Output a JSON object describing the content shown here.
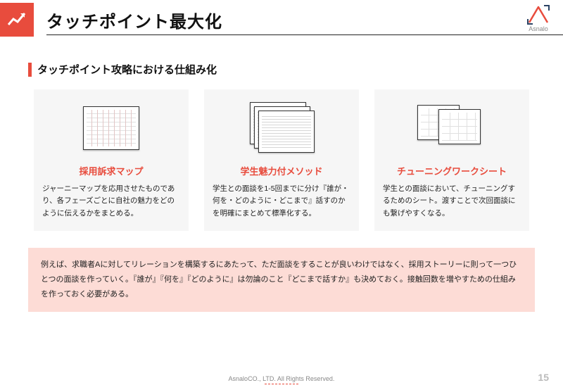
{
  "header": {
    "title": "タッチポイント最大化",
    "brand_name": "Asnalo"
  },
  "subtitle": "タッチポイント攻略における仕組み化",
  "cards": [
    {
      "title": "採用訴求マップ",
      "desc": "ジャーニーマップを応用させたものであり、各フェーズごとに自社の魅力をどのように伝えるかをまとめる。"
    },
    {
      "title": "学生魅力付メソッド",
      "desc": "学生との面談を1-5回までに分け『誰が・何を・どのように・どこまで』話すのかを明確にまとめて標準化する。"
    },
    {
      "title": "チューニングワークシート",
      "desc": "学生との面談において、チューニングするためのシート。渡すことで次回面談にも繋げやすくなる。"
    }
  ],
  "callout": "例えば、求職者Aに対してリレーションを構築するにあたって、ただ面談をすることが良いわけではなく、採用ストーリーに則って一つひとつの面談を作っていく。『誰が』『何を』『どのように』は勿論のこと『どこまで話すか』も決めておく。接触回数を増やすための仕組みを作っておく必要がある。",
  "footer": "AsnaloCO., LTD. All Rights Reserved.",
  "page_number": "15"
}
